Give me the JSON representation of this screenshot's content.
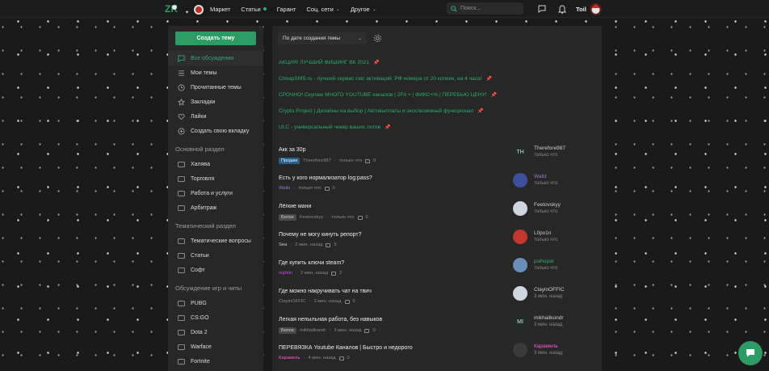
{
  "header": {
    "nav": [
      {
        "label": "Маркет"
      },
      {
        "label": "Статьи"
      },
      {
        "label": "Гарант"
      },
      {
        "label": "Соц. сети"
      },
      {
        "label": "Другое"
      }
    ],
    "search_placeholder": "Поиск...",
    "username": "Toil"
  },
  "sidebar": {
    "create_label": "Создать тему",
    "menu": [
      {
        "label": "Все обсуждения",
        "icon": "chat-bubble-icon"
      },
      {
        "label": "Мои темы",
        "icon": "list-icon"
      },
      {
        "label": "Прочитанные темы",
        "icon": "clock-icon"
      },
      {
        "label": "Закладки",
        "icon": "star-icon"
      },
      {
        "label": "Лайки",
        "icon": "heart-icon"
      },
      {
        "label": "Создать свою вкладку",
        "icon": "plus-circle-icon"
      }
    ],
    "sections": [
      {
        "title": "Основной раздел",
        "items": [
          "Халява",
          "Торговля",
          "Работа и услуги",
          "Арбитраж"
        ]
      },
      {
        "title": "Тематический раздел",
        "items": [
          "Тематические вопросы",
          "Статьи",
          "Софт"
        ]
      },
      {
        "title": "Обсуждение игр и читы",
        "items": [
          "PUBG",
          "CS:GO",
          "Dota 2",
          "Warface",
          "Fortnite"
        ]
      }
    ]
  },
  "main": {
    "sort_label": "По дате создания темы",
    "sticky": [
      "АКЦИЯ! ЛУЧШИЙ ФИШИНГ ВК 2021",
      "CheapSMS.ru - лучший сервис смс активаций. РФ номера от 20 копеек, на 4 часа!",
      "СРОЧНО! Скупаю МНОГО YOUTUBE каналов | 2FA + | ФИКС+% | ПЕРЕБЬЮ ЦЕНУ!",
      "Crypto Project | Дизайны на выбор | Автовыплаты и эксклюзивный функционал",
      "ULC - универсальный чекер ваших логов"
    ],
    "threads": [
      {
        "title": "Акк за 30р",
        "tag": "Продам",
        "tag_color": "blue",
        "author": "Therefore987",
        "author_color": "#8a8a8a",
        "time": "только что",
        "comments": "0",
        "last_user": "Therefore987",
        "last_user_color": "#cfcfcf",
        "last_time": "только что",
        "avatar_text": "TH",
        "avatar_bg": "#1f2d26"
      },
      {
        "title": "Есть у кого нормализатор log:pass?",
        "tag": "",
        "tag_color": "",
        "author": "Waltz",
        "author_color": "#9a78d8",
        "time": "только что",
        "comments": "0",
        "last_user": "Waltz",
        "last_user_color": "#9a78d8",
        "last_time": "только что",
        "avatar_text": "",
        "avatar_bg": "#3b4f9a"
      },
      {
        "title": "Лёгкие мани",
        "tag": "Белое",
        "tag_color": "grey",
        "author": "Feetovskyy",
        "author_color": "#8a8a8a",
        "time": "только что",
        "comments": "0",
        "last_user": "Feetovskyy",
        "last_user_color": "#cfcfcf",
        "last_time": "только что",
        "avatar_text": "",
        "avatar_bg": "#cfd6df"
      },
      {
        "title": "Почему не могу кинуть репорт?",
        "tag": "",
        "tag_color": "",
        "author": "Sea",
        "author_color": "#d0d0d0",
        "time": "2 мин. назад",
        "comments": "5",
        "last_user": "L0px1n",
        "last_user_color": "#cfcfcf",
        "last_time": "только что",
        "avatar_text": "",
        "avatar_bg": "#c2382e"
      },
      {
        "title": "Где купить ключи steam?",
        "tag": "",
        "tag_color": "",
        "author": "nightin",
        "author_color": "#c24fd8",
        "time": "2 мин. назад",
        "comments": "2",
        "last_user": "psihopat",
        "last_user_color": "#2bad72",
        "last_time": "только что",
        "avatar_text": "",
        "avatar_bg": "#6a8db8"
      },
      {
        "title": "Где можно накручивать чат на твич",
        "tag": "",
        "tag_color": "",
        "author": "ClayinOFFIC",
        "author_color": "#8a8a8a",
        "time": "3 мин. назад",
        "comments": "0",
        "last_user": "ClayinOFFIC",
        "last_user_color": "#cfcfcf",
        "last_time": "3 мин. назад",
        "avatar_text": "",
        "avatar_bg": "#cfd6df"
      },
      {
        "title": "Легкая непыльная работа, без навыков",
        "tag": "Белое",
        "tag_color": "grey",
        "author": "mikhailkondr",
        "author_color": "#8a8a8a",
        "time": "3 мин. назад",
        "comments": "0",
        "last_user": "mikhailkondr",
        "last_user_color": "#cfcfcf",
        "last_time": "3 мин. назад",
        "avatar_text": "MI",
        "avatar_bg": "#1f2d26"
      },
      {
        "title": "ПЕРЕВЯЗКА Youtube Каналов | Быстро и недорого",
        "tag": "",
        "tag_color": "",
        "author": "Карамель",
        "author_color": "#ff5ad9",
        "time": "4 мин. назад",
        "comments": "0",
        "last_user": "Карамель",
        "last_user_color": "#ff5ad9",
        "last_time": "3 мин. назад",
        "avatar_text": "",
        "avatar_bg": "#3a3a3a"
      }
    ]
  }
}
